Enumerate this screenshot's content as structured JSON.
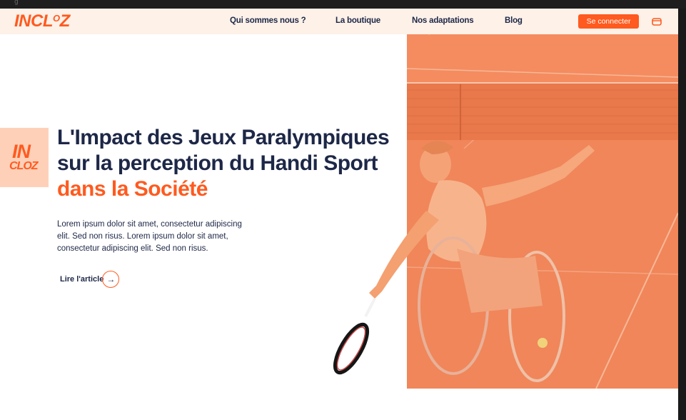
{
  "browser": {
    "tab_hint": "g"
  },
  "brand": {
    "logo_text": "INCL",
    "logo_sup": "O",
    "logo_tail": "Z",
    "accent": "#ff5a1f",
    "navy": "#1d2747"
  },
  "nav": {
    "items": [
      "Qui sommes nous ?",
      "La boutique",
      "Nos adaptations",
      "Blog"
    ],
    "connect_label": "Se connecter"
  },
  "badge": {
    "line1": "IN",
    "line2": "CLOZ"
  },
  "hero": {
    "title_main": "L'Impact des Jeux Paralympiques sur la perception du Handi Sport ",
    "title_accent": "dans la Société",
    "description": "Lorem ipsum dolor sit amet, consectetur adipiscing elit. Sed non risus. Lorem ipsum dolor sit amet, consectetur adipiscing elit. Sed non risus.",
    "cta_label": "Lire l'article",
    "cta_arrow": "→"
  },
  "icons": {
    "cart": "cart-icon",
    "arrow": "arrow-right-icon",
    "image": "wheelchair-tennis-player-photo"
  }
}
